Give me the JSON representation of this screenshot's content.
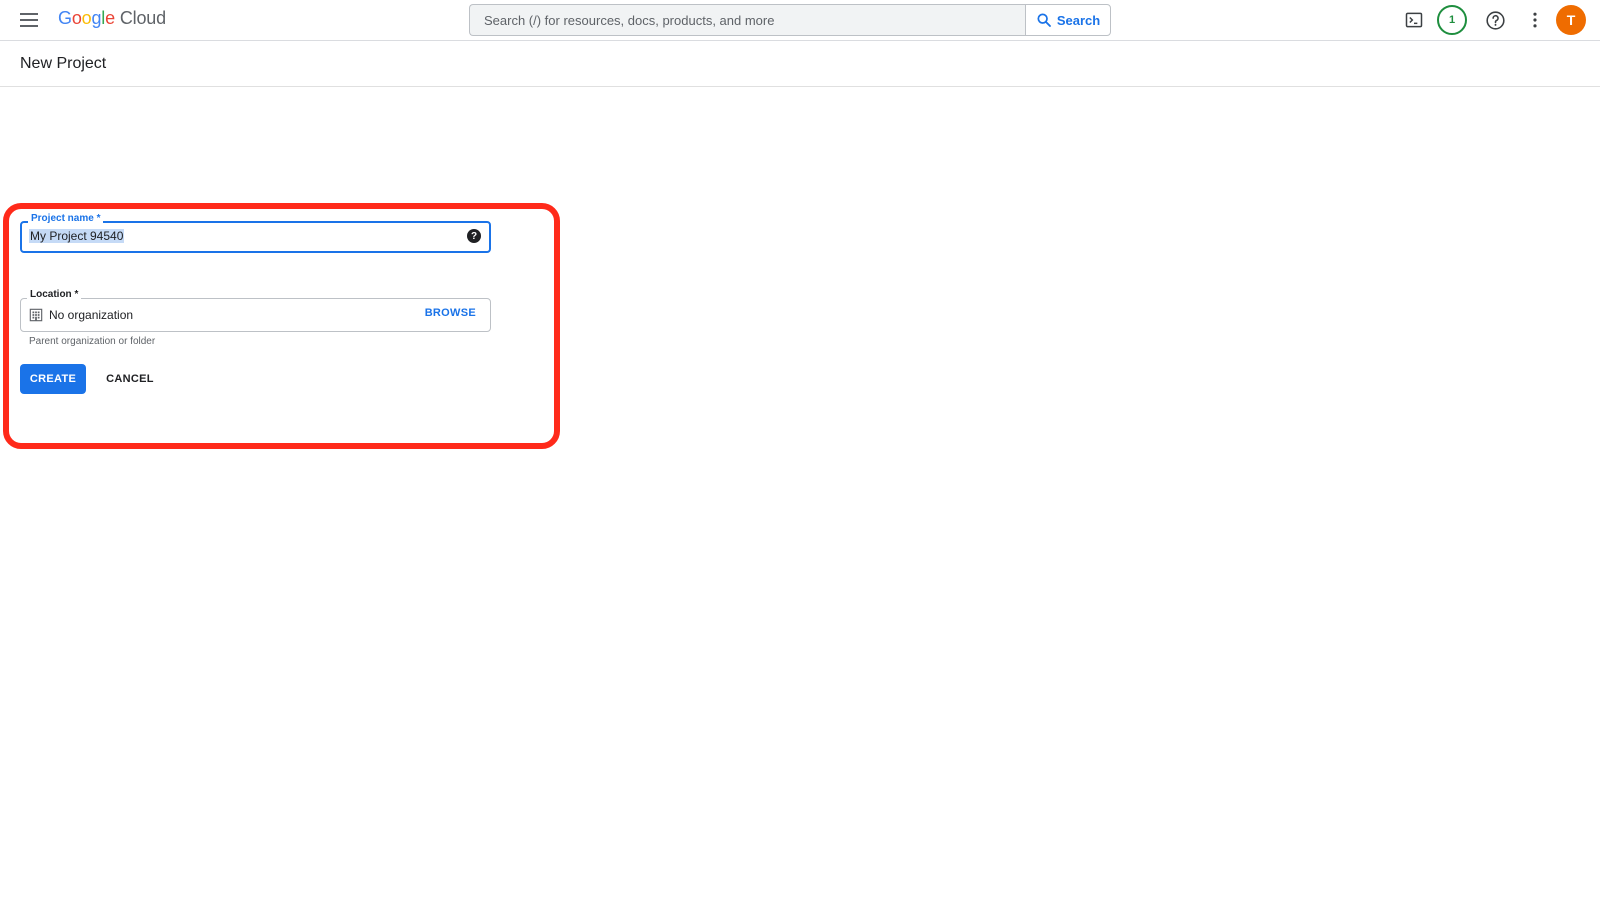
{
  "header": {
    "logo_google": "Google",
    "logo_cloud": "Cloud",
    "search_placeholder": "Search (/) for resources, docs, products, and more",
    "search_button_label": "Search",
    "notification_count": "1",
    "avatar_initial": "T",
    "icons": [
      "menu-icon",
      "search-icon",
      "cloud-shell-icon",
      "help-icon",
      "more-vert-icon"
    ]
  },
  "page": {
    "title": "New Project"
  },
  "form": {
    "project_name_label": "Project name *",
    "project_name_value": "My Project 94540",
    "location_label": "Location *",
    "location_value": "No organization",
    "browse_label": "BROWSE",
    "location_helper": "Parent organization or folder",
    "create_label": "CREATE",
    "cancel_label": "CANCEL"
  },
  "colors": {
    "accent": "#1a73e8",
    "highlight": "#ff2a1a",
    "notification": "#1e8e3e",
    "avatar": "#ef6c00"
  }
}
